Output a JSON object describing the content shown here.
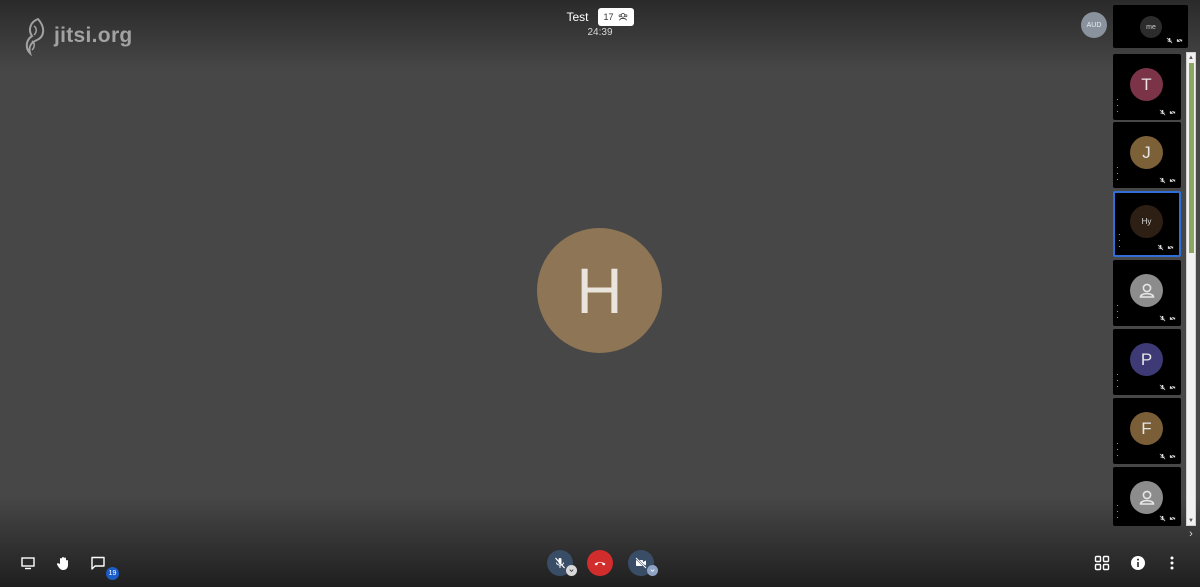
{
  "header": {
    "logo_text": "jitsi.org",
    "conference_name": "Test",
    "participant_count": "17",
    "timer": "24:39"
  },
  "stage": {
    "speaker_initial": "H"
  },
  "audio_badge": "AUD",
  "filmstrip": {
    "local_label": "me",
    "tiles": [
      {
        "initial": "T",
        "color": "#7a3347"
      },
      {
        "initial": "J",
        "color": "#7b6038"
      },
      {
        "initial": "Hy",
        "color": "#2e1f14",
        "active": true
      },
      {
        "initial": "",
        "color": "#8c8c8c",
        "icon": "person-icon"
      },
      {
        "initial": "P",
        "color": "#3d3a75"
      },
      {
        "initial": "F",
        "color": "#7a5e38"
      },
      {
        "initial": "",
        "color": "#8c8c8c",
        "icon": "person-icon"
      }
    ]
  },
  "toolbar": {
    "chat_unread": "19"
  },
  "colors": {
    "background": "#474747",
    "hangup": "#d22d2d",
    "accent": "#2f6fd6",
    "scroll_thumb": "#8aa660"
  }
}
